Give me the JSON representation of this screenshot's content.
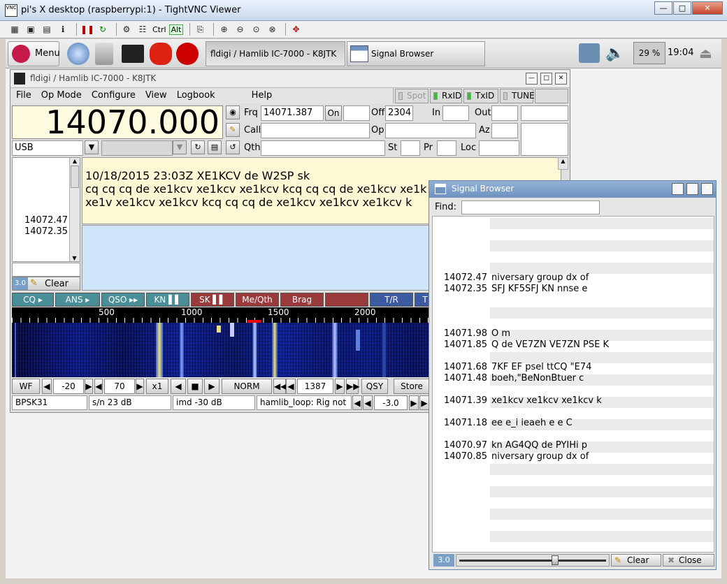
{
  "vnc": {
    "title": "pi's X desktop (raspberrypi:1) - TightVNC Viewer",
    "toolbar_ctrl": "Ctrl",
    "toolbar_alt": "Alt"
  },
  "panel": {
    "menu_label": "Menu",
    "tasks": [
      "fldigi / Hamlib IC-7000 - K8JTK",
      "Signal Browser"
    ],
    "cpu": "29 %",
    "clock": "19:04"
  },
  "fldigi": {
    "title": "fldigi / Hamlib IC-7000 - K8JTK",
    "menu": [
      "File",
      "Op Mode",
      "Configure",
      "View",
      "Logbook",
      "Help"
    ],
    "toggles": [
      "Spot",
      "RxID",
      "TxID",
      "TUNE"
    ],
    "freq": "14070.000",
    "mode": "USB",
    "labels": {
      "frq": "Frq",
      "call": "Call",
      "qth": "Qth",
      "off": "Off",
      "op": "Op",
      "st": "St",
      "pr": "Pr",
      "in": "In",
      "out": "Out",
      "az": "Az",
      "loc": "Loc",
      "on": "On"
    },
    "frq_value": "14071.387",
    "off_value": "2304",
    "rx_lines": [
      "10/18/2015 23:03Z XE1KCV de W2SP sk",
      "cq cq cq de xe1kcv xe1kcv xe1kcv kcq cq cq de xe1kcv xe1k x",
      "xe1v xe1kcv xe1kcv kcq cq cq de xe1kcv xe1kcv xe1kcv k"
    ],
    "left_freqs": [
      "14072.47",
      "14072.35"
    ],
    "clear_value": "3.0",
    "clear_label": "Clear",
    "macros": [
      "CQ ▸",
      "ANS ▸",
      "QSO ▸▸",
      "KN ▌▌",
      "SK ▌▌",
      "Me/Qth",
      "Brag",
      "",
      "T/R",
      "T"
    ],
    "ruler_ticks": [
      "500",
      "1000",
      "1500",
      "2000"
    ],
    "controls": {
      "wf": "WF",
      "lo": "-20",
      "range": "70",
      "zoom": "x1",
      "norm": "NORM",
      "carrier": "1387",
      "qsy": "QSY",
      "store": "Store"
    },
    "status": {
      "mode": "BPSK31",
      "sn": "s/n 23 dB",
      "imd": "imd -30 dB",
      "rig": "hamlib_loop: Rig not",
      "squelch": "-3.0"
    }
  },
  "signal_browser": {
    "title": "Signal Browser",
    "find_label": "Find:",
    "find_value": "",
    "rows": [
      {
        "f": "14072.47",
        "t": "niversary  group dx of"
      },
      {
        "f": "14072.35",
        "t": "SFJ  KF5SFJ  KN nnse  e"
      },
      {
        "f": "14071.98",
        "t": "O m"
      },
      {
        "f": "14071.85",
        "t": "Q de VE7ZN VE7ZN PSE K"
      },
      {
        "f": "14071.68",
        "t": "7KF EF  psel ttCQ \"E74"
      },
      {
        "f": "14071.48",
        "t": "boeh,\"BeNonBtuer c"
      },
      {
        "f": "14071.39",
        "t": " xe1kcv xe1kcv xe1kcv k"
      },
      {
        "f": "14071.18",
        "t": "ee e_i ieaeh e  e     C"
      },
      {
        "f": "14070.97",
        "t": " kn    AG4QQ de PYIHi p"
      },
      {
        "f": "14070.85",
        "t": "niversary  group dx of"
      }
    ],
    "squelch": "3.0",
    "clear_label": "Clear",
    "close_label": "Close"
  }
}
